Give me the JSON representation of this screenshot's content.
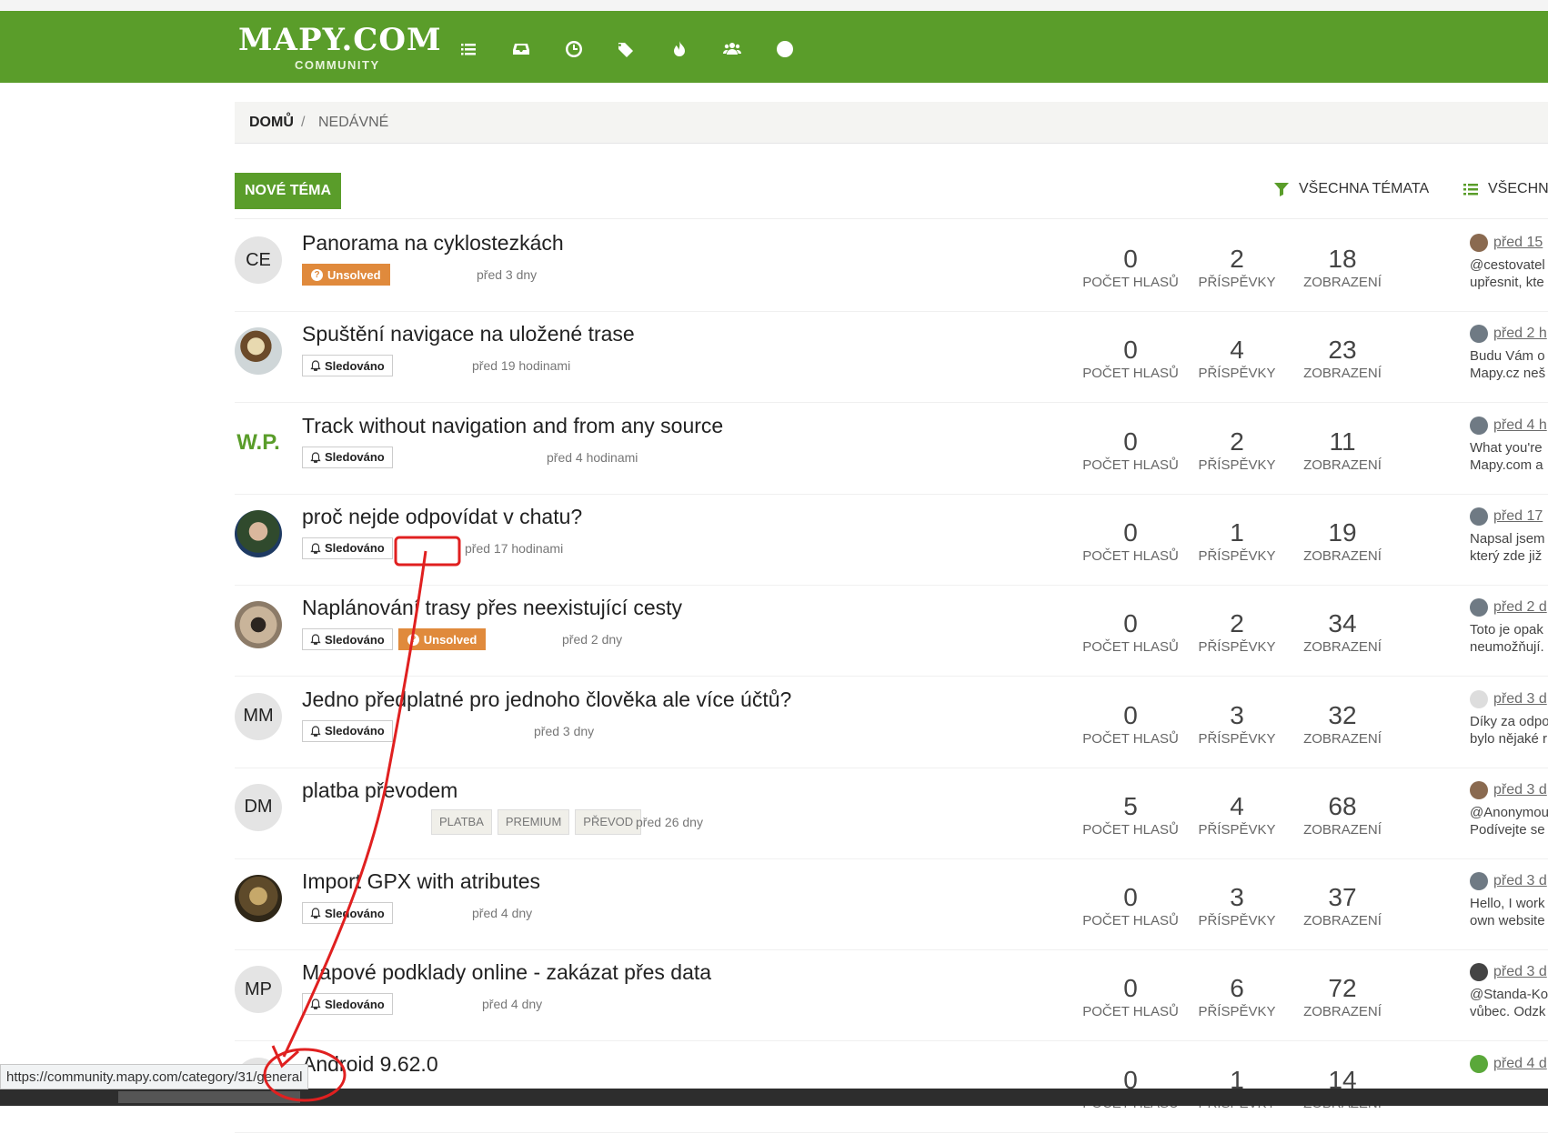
{
  "header": {
    "logo_main": "MAPY.COM",
    "logo_sub": "COMMUNITY",
    "nav_icons": [
      "list-icon",
      "inbox-icon",
      "clock-icon",
      "tags-icon",
      "fire-icon",
      "users-icon",
      "globe-icon"
    ],
    "color": "#5a9d2a"
  },
  "breadcrumb": {
    "home": "DOMŮ",
    "separator": "/",
    "current": "NEDÁVNÉ"
  },
  "toolbar": {
    "new_topic": "NOVÉ TÉMA",
    "filter_all": "VŠECHNA TÉMATA",
    "filter_categories": "VŠECHN"
  },
  "stat_labels": {
    "votes": "POČET HLASŮ",
    "posts": "PŘÍSPĚVKY",
    "views": "ZOBRAZENÍ"
  },
  "topics": [
    {
      "title": "Panorama na cyklostezkách",
      "avatar": "CE",
      "watched": false,
      "unsolved": true,
      "time": "před 3 dny",
      "votes": "0",
      "posts": "2",
      "views": "18",
      "last_when": "před 15",
      "last_text1": "@cestovatel",
      "last_text2": "upřesnit, kte"
    },
    {
      "title": "Spuštění navigace na uložené trase",
      "avatar": "",
      "watched": true,
      "unsolved": false,
      "time": "před 19 hodinami",
      "votes": "0",
      "posts": "4",
      "views": "23",
      "last_when": "před 2 h",
      "last_text1": "Budu Vám o",
      "last_text2": "Mapy.cz neš"
    },
    {
      "title": "Track without navigation and from any source",
      "avatar": "W.P.",
      "watched": true,
      "unsolved": false,
      "time": "před 4 hodinami",
      "votes": "0",
      "posts": "2",
      "views": "11",
      "last_when": "před 4 h",
      "last_text1": "What you're",
      "last_text2": "Mapy.com a"
    },
    {
      "title": "proč nejde odpovídat v chatu?",
      "avatar": "",
      "watched": true,
      "unsolved": false,
      "time": "před 17 hodinami",
      "votes": "0",
      "posts": "1",
      "views": "19",
      "last_when": "před 17",
      "last_text1": "Napsal jsem",
      "last_text2": "který zde již"
    },
    {
      "title": "Naplánování trasy přes neexistující cesty",
      "avatar": "",
      "watched": true,
      "unsolved": true,
      "time": "před 2 dny",
      "votes": "0",
      "posts": "2",
      "views": "34",
      "last_when": "před 2 d",
      "last_text1": "Toto je opak",
      "last_text2": "neumožňují."
    },
    {
      "title": "Jedno předplatné pro jednoho člověka ale více účtů?",
      "avatar": "MM",
      "watched": true,
      "unsolved": false,
      "time": "před 3 dny",
      "votes": "0",
      "posts": "3",
      "views": "32",
      "last_when": "před 3 d",
      "last_text1": "Díky za odpo",
      "last_text2": "bylo nějaké r"
    },
    {
      "title": "platba převodem",
      "avatar": "DM",
      "watched": false,
      "unsolved": false,
      "tags": [
        "PLATBA",
        "PREMIUM",
        "PŘEVOD"
      ],
      "time": "před 26 dny",
      "votes": "5",
      "posts": "4",
      "views": "68",
      "last_when": "před 3 d",
      "last_text1": "@Anonymou",
      "last_text2": "Podívejte se"
    },
    {
      "title": "Import GPX with atributes",
      "avatar": "",
      "watched": true,
      "unsolved": false,
      "time": "před 4 dny",
      "votes": "0",
      "posts": "3",
      "views": "37",
      "last_when": "před 3 d",
      "last_text1": "Hello, I work",
      "last_text2": "own website"
    },
    {
      "title": "Mapové podklady online - zakázat přes data",
      "avatar": "MP",
      "watched": true,
      "unsolved": false,
      "time": "před 4 dny",
      "votes": "0",
      "posts": "6",
      "views": "72",
      "last_when": "před 3 d",
      "last_text1": "@Standa-Ko",
      "last_text2": "vůbec. Odzk"
    },
    {
      "title": "Android 9.62.0",
      "avatar": "",
      "watched": false,
      "unsolved": false,
      "time": "",
      "votes": "0",
      "posts": "1",
      "views": "14",
      "last_when": "před 4 d",
      "last_text1": "",
      "last_text2": ""
    }
  ],
  "labels": {
    "watched": "Sledováno",
    "unsolved": "Unsolved"
  },
  "status_url": "https://community.mapy.com/category/31/general"
}
